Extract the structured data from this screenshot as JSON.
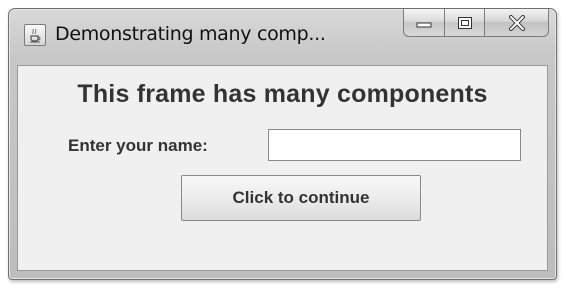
{
  "window": {
    "title": "Demonstrating many comp...",
    "app_icon": "java-cup-icon",
    "controls": {
      "minimize_icon": "minimize-icon",
      "maximize_icon": "maximize-icon",
      "close_icon": "close-icon"
    }
  },
  "content": {
    "heading": "This frame has many components",
    "name_label": "Enter your name:",
    "name_input": {
      "value": "",
      "placeholder": ""
    },
    "continue_button": "Click to continue"
  }
}
